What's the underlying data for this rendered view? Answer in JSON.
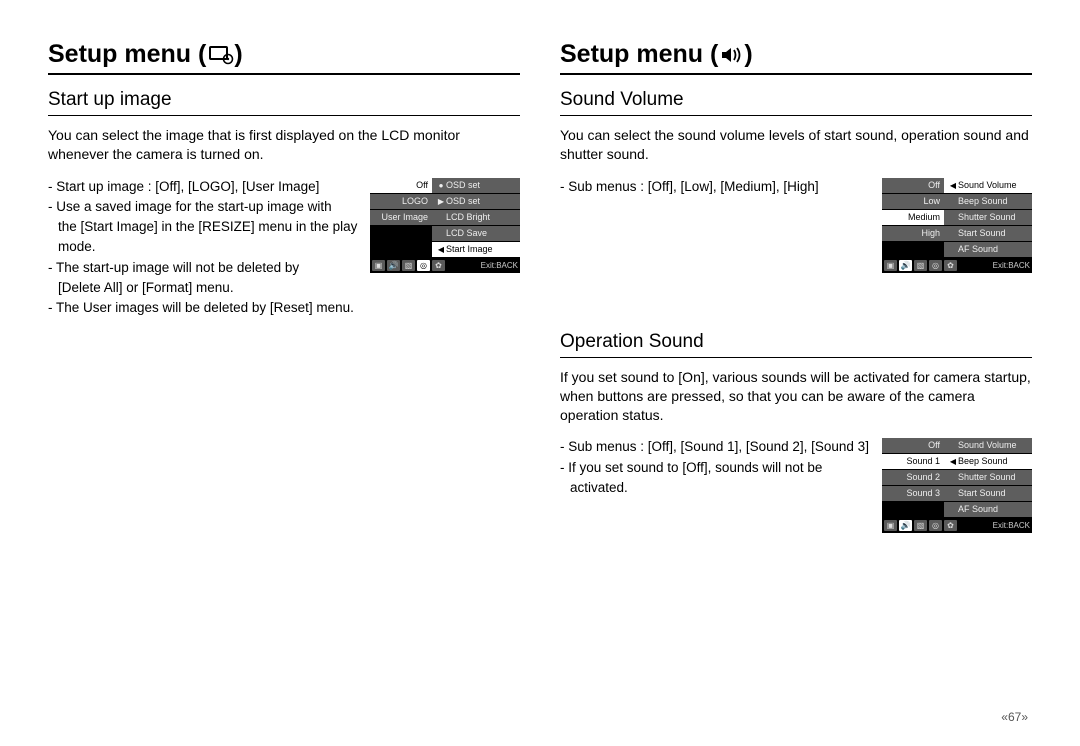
{
  "left": {
    "title_prefix": "Setup menu (",
    "title_suffix": ")",
    "section1": {
      "heading": "Start up image",
      "desc": "You can select the image that is first displayed on the LCD monitor whenever the camera is turned on.",
      "lines": [
        "- Start up image : [Off], [LOGO], [User Image]",
        "- Use a saved image for the start-up image with",
        "  the [Start Image] in the [RESIZE] menu in the play",
        "  mode.",
        "- The start-up image will not be deleted by",
        "  [Delete All] or [Format] menu.",
        "- The User images will be deleted by [Reset] menu."
      ],
      "menu_left": [
        {
          "label": "Off",
          "sel": true
        },
        {
          "label": "LOGO",
          "sel": false
        },
        {
          "label": "User Image",
          "sel": false
        },
        {
          "label": "",
          "sel": false,
          "black": true
        },
        {
          "label": "",
          "sel": false,
          "black": true
        }
      ],
      "menu_right": [
        {
          "label": "OSD set",
          "tri": "●"
        },
        {
          "label": "OSD set",
          "tri": "▶"
        },
        {
          "label": "LCD Bright",
          "tri": ""
        },
        {
          "label": "LCD Save",
          "tri": ""
        },
        {
          "label": "Start Image",
          "tri": "◀",
          "sel": true
        }
      ],
      "exit": "Exit:BACK",
      "sel_tab": 3
    }
  },
  "right": {
    "title_prefix": "Setup menu (",
    "title_suffix": ")",
    "section1": {
      "heading": "Sound Volume",
      "desc": "You can select the sound volume levels of start sound, operation sound and shutter sound.",
      "lines": [
        "- Sub menus : [Off], [Low], [Medium], [High]"
      ],
      "menu_left": [
        {
          "label": "Off"
        },
        {
          "label": "Low"
        },
        {
          "label": "Medium",
          "sel": true
        },
        {
          "label": "High"
        },
        {
          "label": "",
          "black": true
        }
      ],
      "menu_right": [
        {
          "label": "Sound Volume",
          "tri": "◀",
          "sel": true
        },
        {
          "label": "Beep Sound",
          "tri": ""
        },
        {
          "label": "Shutter Sound",
          "tri": ""
        },
        {
          "label": "Start Sound",
          "tri": ""
        },
        {
          "label": "AF Sound",
          "tri": ""
        }
      ],
      "exit": "Exit:BACK",
      "sel_tab": 1
    },
    "section2": {
      "heading": "Operation Sound",
      "desc": "If you set sound to [On], various sounds will be activated for camera startup, when buttons are pressed, so that you can be aware of the camera operation status.",
      "lines": [
        "- Sub menus : [Off], [Sound 1], [Sound 2], [Sound 3]",
        "- If you set sound to [Off], sounds will not be",
        "  activated."
      ],
      "menu_left": [
        {
          "label": "Off"
        },
        {
          "label": "Sound 1",
          "sel": true
        },
        {
          "label": "Sound 2"
        },
        {
          "label": "Sound 3"
        },
        {
          "label": "",
          "black": true
        }
      ],
      "menu_right": [
        {
          "label": "Sound Volume",
          "tri": ""
        },
        {
          "label": "Beep Sound",
          "tri": "◀",
          "sel": true
        },
        {
          "label": "Shutter Sound",
          "tri": ""
        },
        {
          "label": "Start Sound",
          "tri": ""
        },
        {
          "label": "AF Sound",
          "tri": ""
        }
      ],
      "exit": "Exit:BACK",
      "sel_tab": 1
    }
  },
  "page_number": "«67»",
  "footer_icons": [
    "▣",
    "🔊",
    "▧",
    "◎",
    "✿"
  ]
}
